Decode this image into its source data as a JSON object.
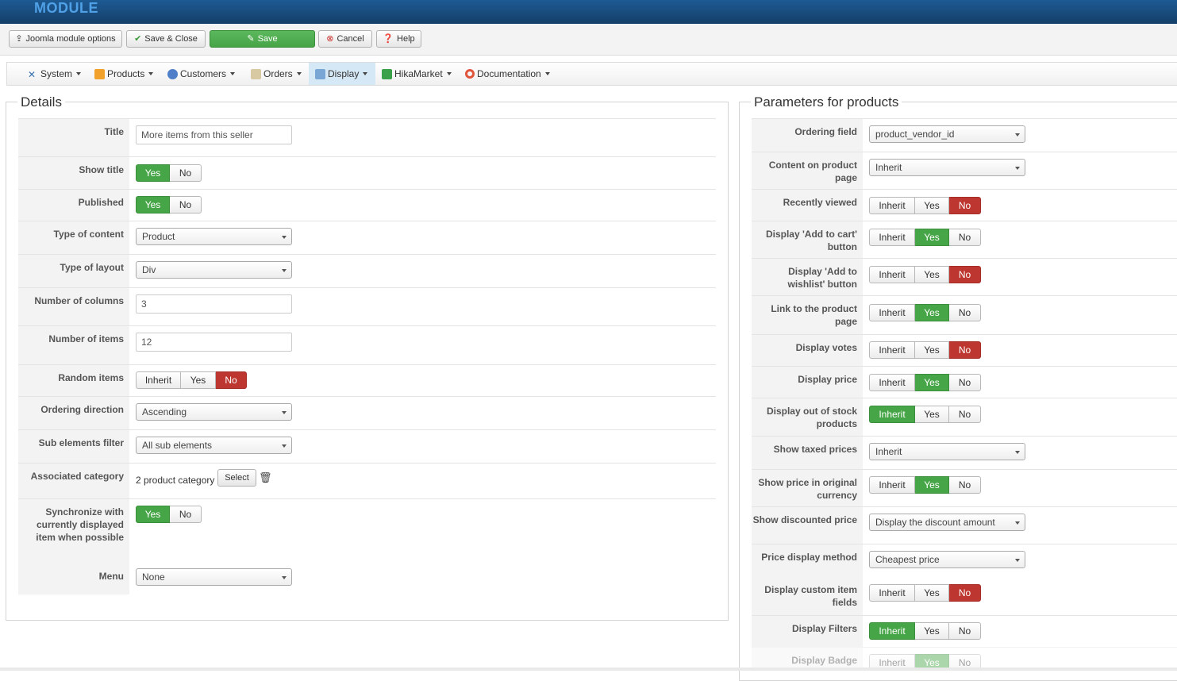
{
  "header": {
    "title": "MODULE"
  },
  "toolbar": {
    "joomla_options": "Joomla module options",
    "save_close": "Save & Close",
    "save": "Save",
    "cancel": "Cancel",
    "help": "Help"
  },
  "menu": {
    "system": "System",
    "products": "Products",
    "customers": "Customers",
    "orders": "Orders",
    "display": "Display",
    "hikamarket": "HikaMarket",
    "documentation": "Documentation"
  },
  "details": {
    "legend": "Details",
    "title_label": "Title",
    "title_value": "More items from this seller",
    "show_title_label": "Show title",
    "published_label": "Published",
    "type_content_label": "Type of content",
    "type_content_value": "Product",
    "type_layout_label": "Type of layout",
    "type_layout_value": "Div",
    "columns_label": "Number of columns",
    "columns_value": "3",
    "items_label": "Number of items",
    "items_value": "12",
    "random_label": "Random items",
    "ordering_dir_label": "Ordering direction",
    "ordering_dir_value": "Ascending",
    "sub_filter_label": "Sub elements filter",
    "sub_filter_value": "All sub elements",
    "assoc_cat_label": "Associated category",
    "assoc_cat_value": "2 product category",
    "select_btn": "Select",
    "sync_label": "Synchronize with currently displayed item when possible",
    "menu_label": "Menu",
    "menu_value": "None"
  },
  "options": {
    "yes": "Yes",
    "no": "No",
    "inherit": "Inherit"
  },
  "params": {
    "legend": "Parameters for products",
    "ordering_field_label": "Ordering field",
    "ordering_field_value": "product_vendor_id",
    "content_on_page_label": "Content on product page",
    "content_on_page_value": "Inherit",
    "recently_viewed_label": "Recently viewed",
    "add_to_cart_label": "Display 'Add to cart' button",
    "add_to_wishlist_label": "Display 'Add to wishlist' button",
    "link_product_label": "Link to the product page",
    "votes_label": "Display votes",
    "price_label": "Display price",
    "out_of_stock_label": "Display out of stock products",
    "taxed_prices_label": "Show taxed prices",
    "taxed_prices_value": "Inherit",
    "orig_currency_label": "Show price in original currency",
    "discounted_label": "Show discounted price",
    "discounted_value": "Display the discount amount",
    "price_method_label": "Price display method",
    "price_method_value": "Cheapest price",
    "custom_fields_label": "Display custom item fields",
    "filters_label": "Display Filters",
    "badge_label": "Display Badge"
  },
  "colors": {
    "header": "#1d5a93",
    "green": "#46a546",
    "red": "#bd362f",
    "active_tab": "#d5e8f6"
  }
}
